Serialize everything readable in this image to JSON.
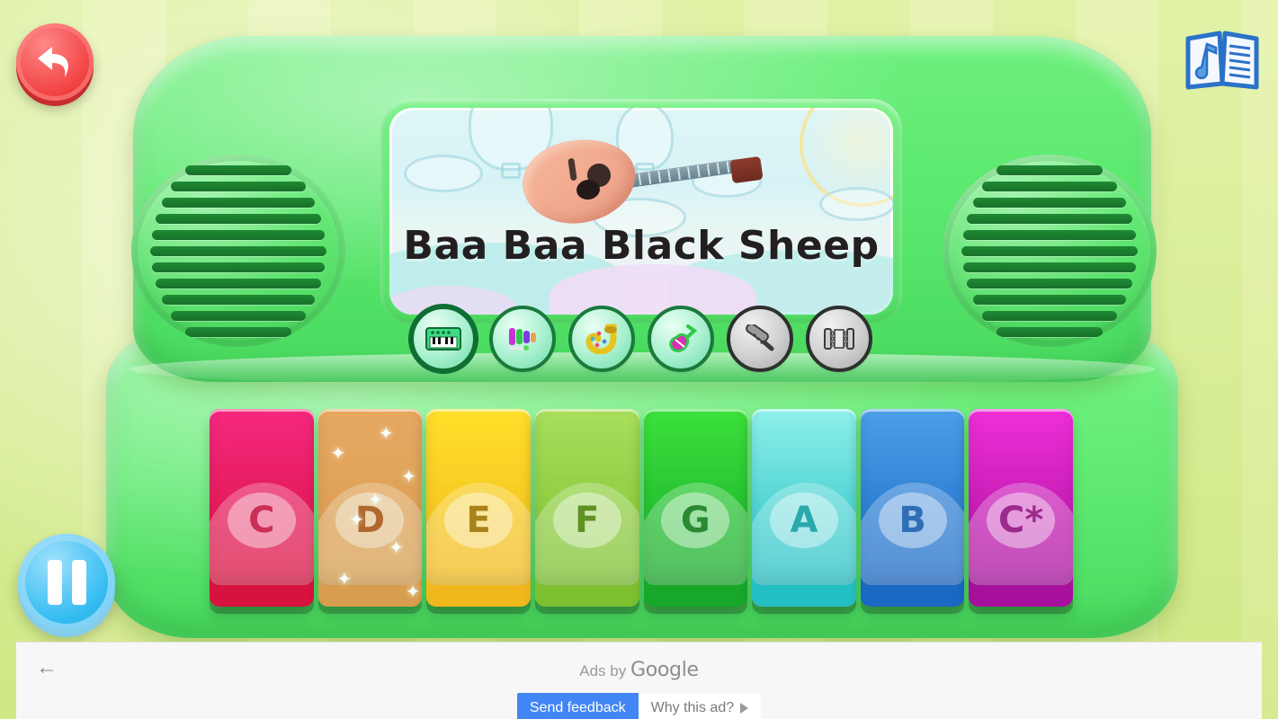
{
  "app": {
    "song_title": "Baa Baa Black Sheep",
    "background_color": "#dcef9a",
    "body_color": "#5ce96f"
  },
  "controls": {
    "back_button_label": "Back",
    "back_icon": "undo-arrow-icon",
    "songbook_button_label": "Songbook",
    "songbook_icon": "open-book-music-icon",
    "pause_button_label": "Pause",
    "pause_icon": "pause-icon"
  },
  "instruments": [
    {
      "name": "Piano",
      "icon": "piano-icon",
      "selected": true,
      "locked": false,
      "glyph": ""
    },
    {
      "name": "Xylophone",
      "icon": "xylophone-icon",
      "selected": false,
      "locked": false,
      "glyph": ""
    },
    {
      "name": "Saxophone",
      "icon": "saxophone-icon",
      "selected": false,
      "locked": false,
      "glyph": ""
    },
    {
      "name": "Electric Guitar",
      "icon": "guitar-icon",
      "selected": false,
      "locked": false,
      "glyph": ""
    },
    {
      "name": "Clarinet",
      "icon": "clarinet-icon",
      "selected": false,
      "locked": true,
      "glyph": ""
    },
    {
      "name": "Accordion",
      "icon": "accordion-icon",
      "selected": false,
      "locked": true,
      "glyph": ""
    }
  ],
  "keys": [
    {
      "note": "C",
      "top": "#f5287f",
      "bottom": "#d8123f",
      "label_color": "#cc2f55",
      "pressed": false
    },
    {
      "note": "D",
      "top": "#eba45e",
      "bottom": "#e09a4e",
      "label_color": "#b3622a",
      "pressed": true
    },
    {
      "note": "E",
      "top": "#ffe02a",
      "bottom": "#f0b81c",
      "label_color": "#a8821a",
      "pressed": false
    },
    {
      "note": "F",
      "top": "#a8df5c",
      "bottom": "#7cc02f",
      "label_color": "#5f9124",
      "pressed": false
    },
    {
      "note": "G",
      "top": "#3ce23c",
      "bottom": "#17a82a",
      "label_color": "#2a8a32",
      "pressed": false
    },
    {
      "note": "A",
      "top": "#8ff0ea",
      "bottom": "#22bfc4",
      "label_color": "#2aa9ab",
      "pressed": false
    },
    {
      "note": "B",
      "top": "#4c9fe8",
      "bottom": "#1968c4",
      "label_color": "#2f6fb5",
      "pressed": false
    },
    {
      "note": "C*",
      "top": "#ef2fd8",
      "bottom": "#a7109c",
      "label_color": "#9c2a8c",
      "pressed": false
    }
  ],
  "screen": {
    "illustration": "acoustic-guitar-with-hot-air-balloons",
    "title": "Baa Baa Black Sheep"
  },
  "ad": {
    "back_icon": "left-arrow-icon",
    "ads_by_prefix": "Ads by",
    "ads_by_brand": "Google",
    "send_feedback_label": "Send feedback",
    "why_this_ad_label": "Why this ad?",
    "adchoices_icon": "adchoices-icon",
    "feedback_color": "#4285f4"
  }
}
